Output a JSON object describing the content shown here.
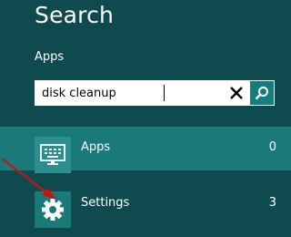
{
  "title": "Search",
  "scope_label": "Apps",
  "search": {
    "value": "disk cleanup"
  },
  "results": {
    "apps": {
      "label": "Apps",
      "count": "0",
      "icon": "keyboard-icon"
    },
    "settings": {
      "label": "Settings",
      "count": "3",
      "icon": "gear-icon"
    }
  },
  "colors": {
    "background": "#0f4a4f",
    "selected_row": "#1a7a7a",
    "search_button": "#137d82",
    "arrow": "#cc1111"
  }
}
